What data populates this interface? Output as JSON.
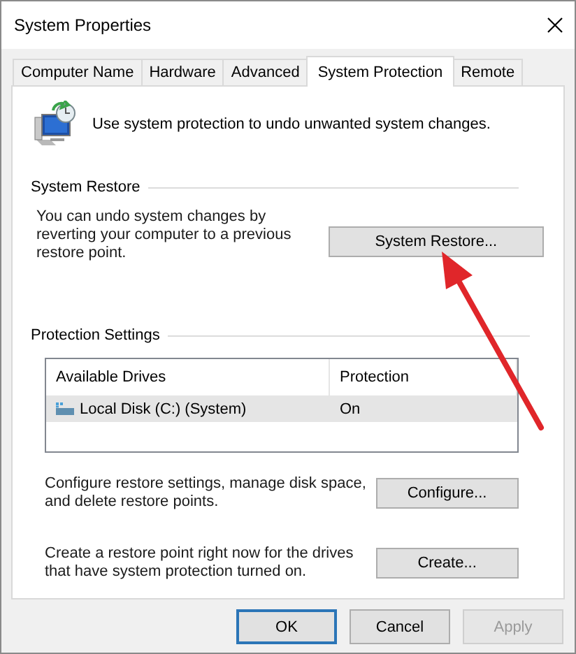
{
  "window": {
    "title": "System Properties"
  },
  "tabs": [
    {
      "label": "Computer Name",
      "selected": false
    },
    {
      "label": "Hardware",
      "selected": false
    },
    {
      "label": "Advanced",
      "selected": false
    },
    {
      "label": "System Protection",
      "selected": true
    },
    {
      "label": "Remote",
      "selected": false
    }
  ],
  "intro": "Use system protection to undo unwanted system changes.",
  "system_restore": {
    "title": "System Restore",
    "description": "You can undo system changes by reverting your computer to a previous restore point.",
    "button": "System Restore..."
  },
  "protection_settings": {
    "title": "Protection Settings",
    "table": {
      "columns": [
        "Available Drives",
        "Protection"
      ],
      "rows": [
        {
          "drive": "Local Disk (C:) (System)",
          "protection": "On",
          "selected": true
        }
      ]
    },
    "actions": [
      {
        "description": "Configure restore settings, manage disk space, and delete restore points.",
        "button": "Configure..."
      },
      {
        "description": "Create a restore point right now for the drives that have system protection turned on.",
        "button": "Create..."
      }
    ]
  },
  "buttons": [
    {
      "label": "OK",
      "default": true,
      "disabled": false
    },
    {
      "label": "Cancel",
      "default": false,
      "disabled": false
    },
    {
      "label": "Apply",
      "default": false,
      "disabled": true
    }
  ]
}
